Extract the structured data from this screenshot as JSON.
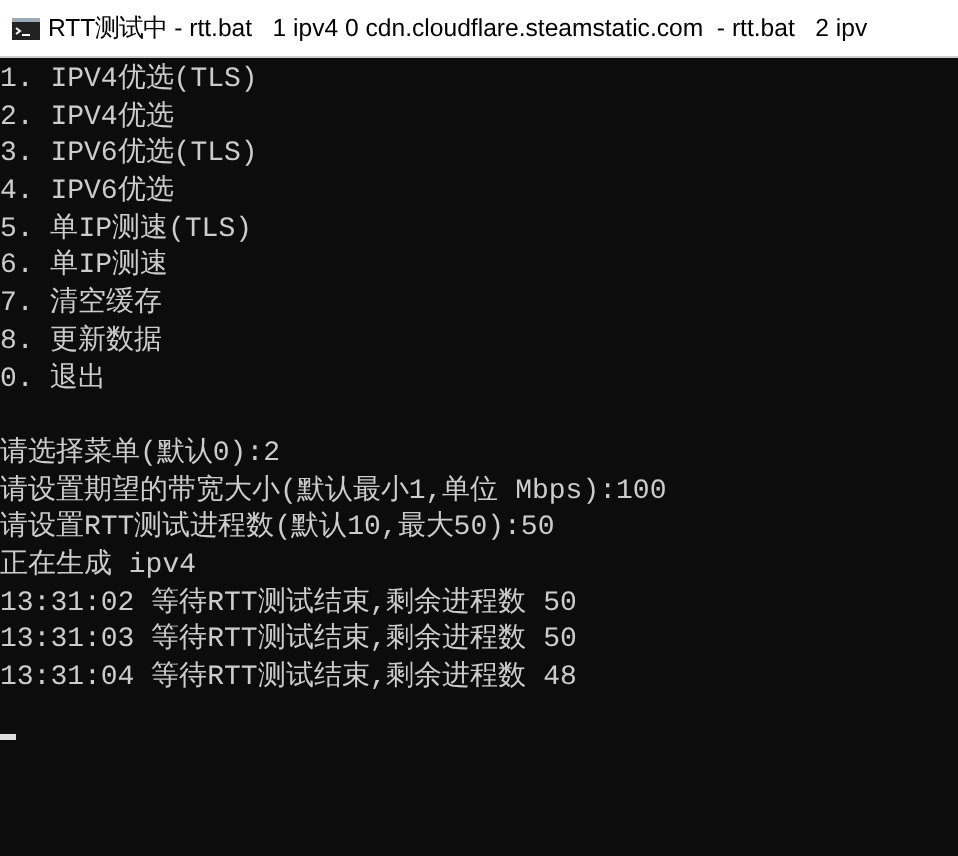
{
  "window": {
    "title": "RTT测试中 - rtt.bat   1 ipv4 0 cdn.cloudflare.steamstatic.com  - rtt.bat   2 ipv"
  },
  "console": {
    "menu": [
      "1. IPV4优选(TLS)",
      "2. IPV4优选",
      "3. IPV6优选(TLS)",
      "4. IPV6优选",
      "5. 单IP测速(TLS)",
      "6. 单IP测速",
      "7. 清空缓存",
      "8. 更新数据",
      "0. 退出"
    ],
    "output": [
      "请选择菜单(默认0):2",
      "请设置期望的带宽大小(默认最小1,单位 Mbps):100",
      "请设置RTT测试进程数(默认10,最大50):50",
      "正在生成 ipv4",
      "13:31:02 等待RTT测试结束,剩余进程数 50",
      "13:31:03 等待RTT测试结束,剩余进程数 50",
      "13:31:04 等待RTT测试结束,剩余进程数 48"
    ],
    "cursor_visible": true
  }
}
